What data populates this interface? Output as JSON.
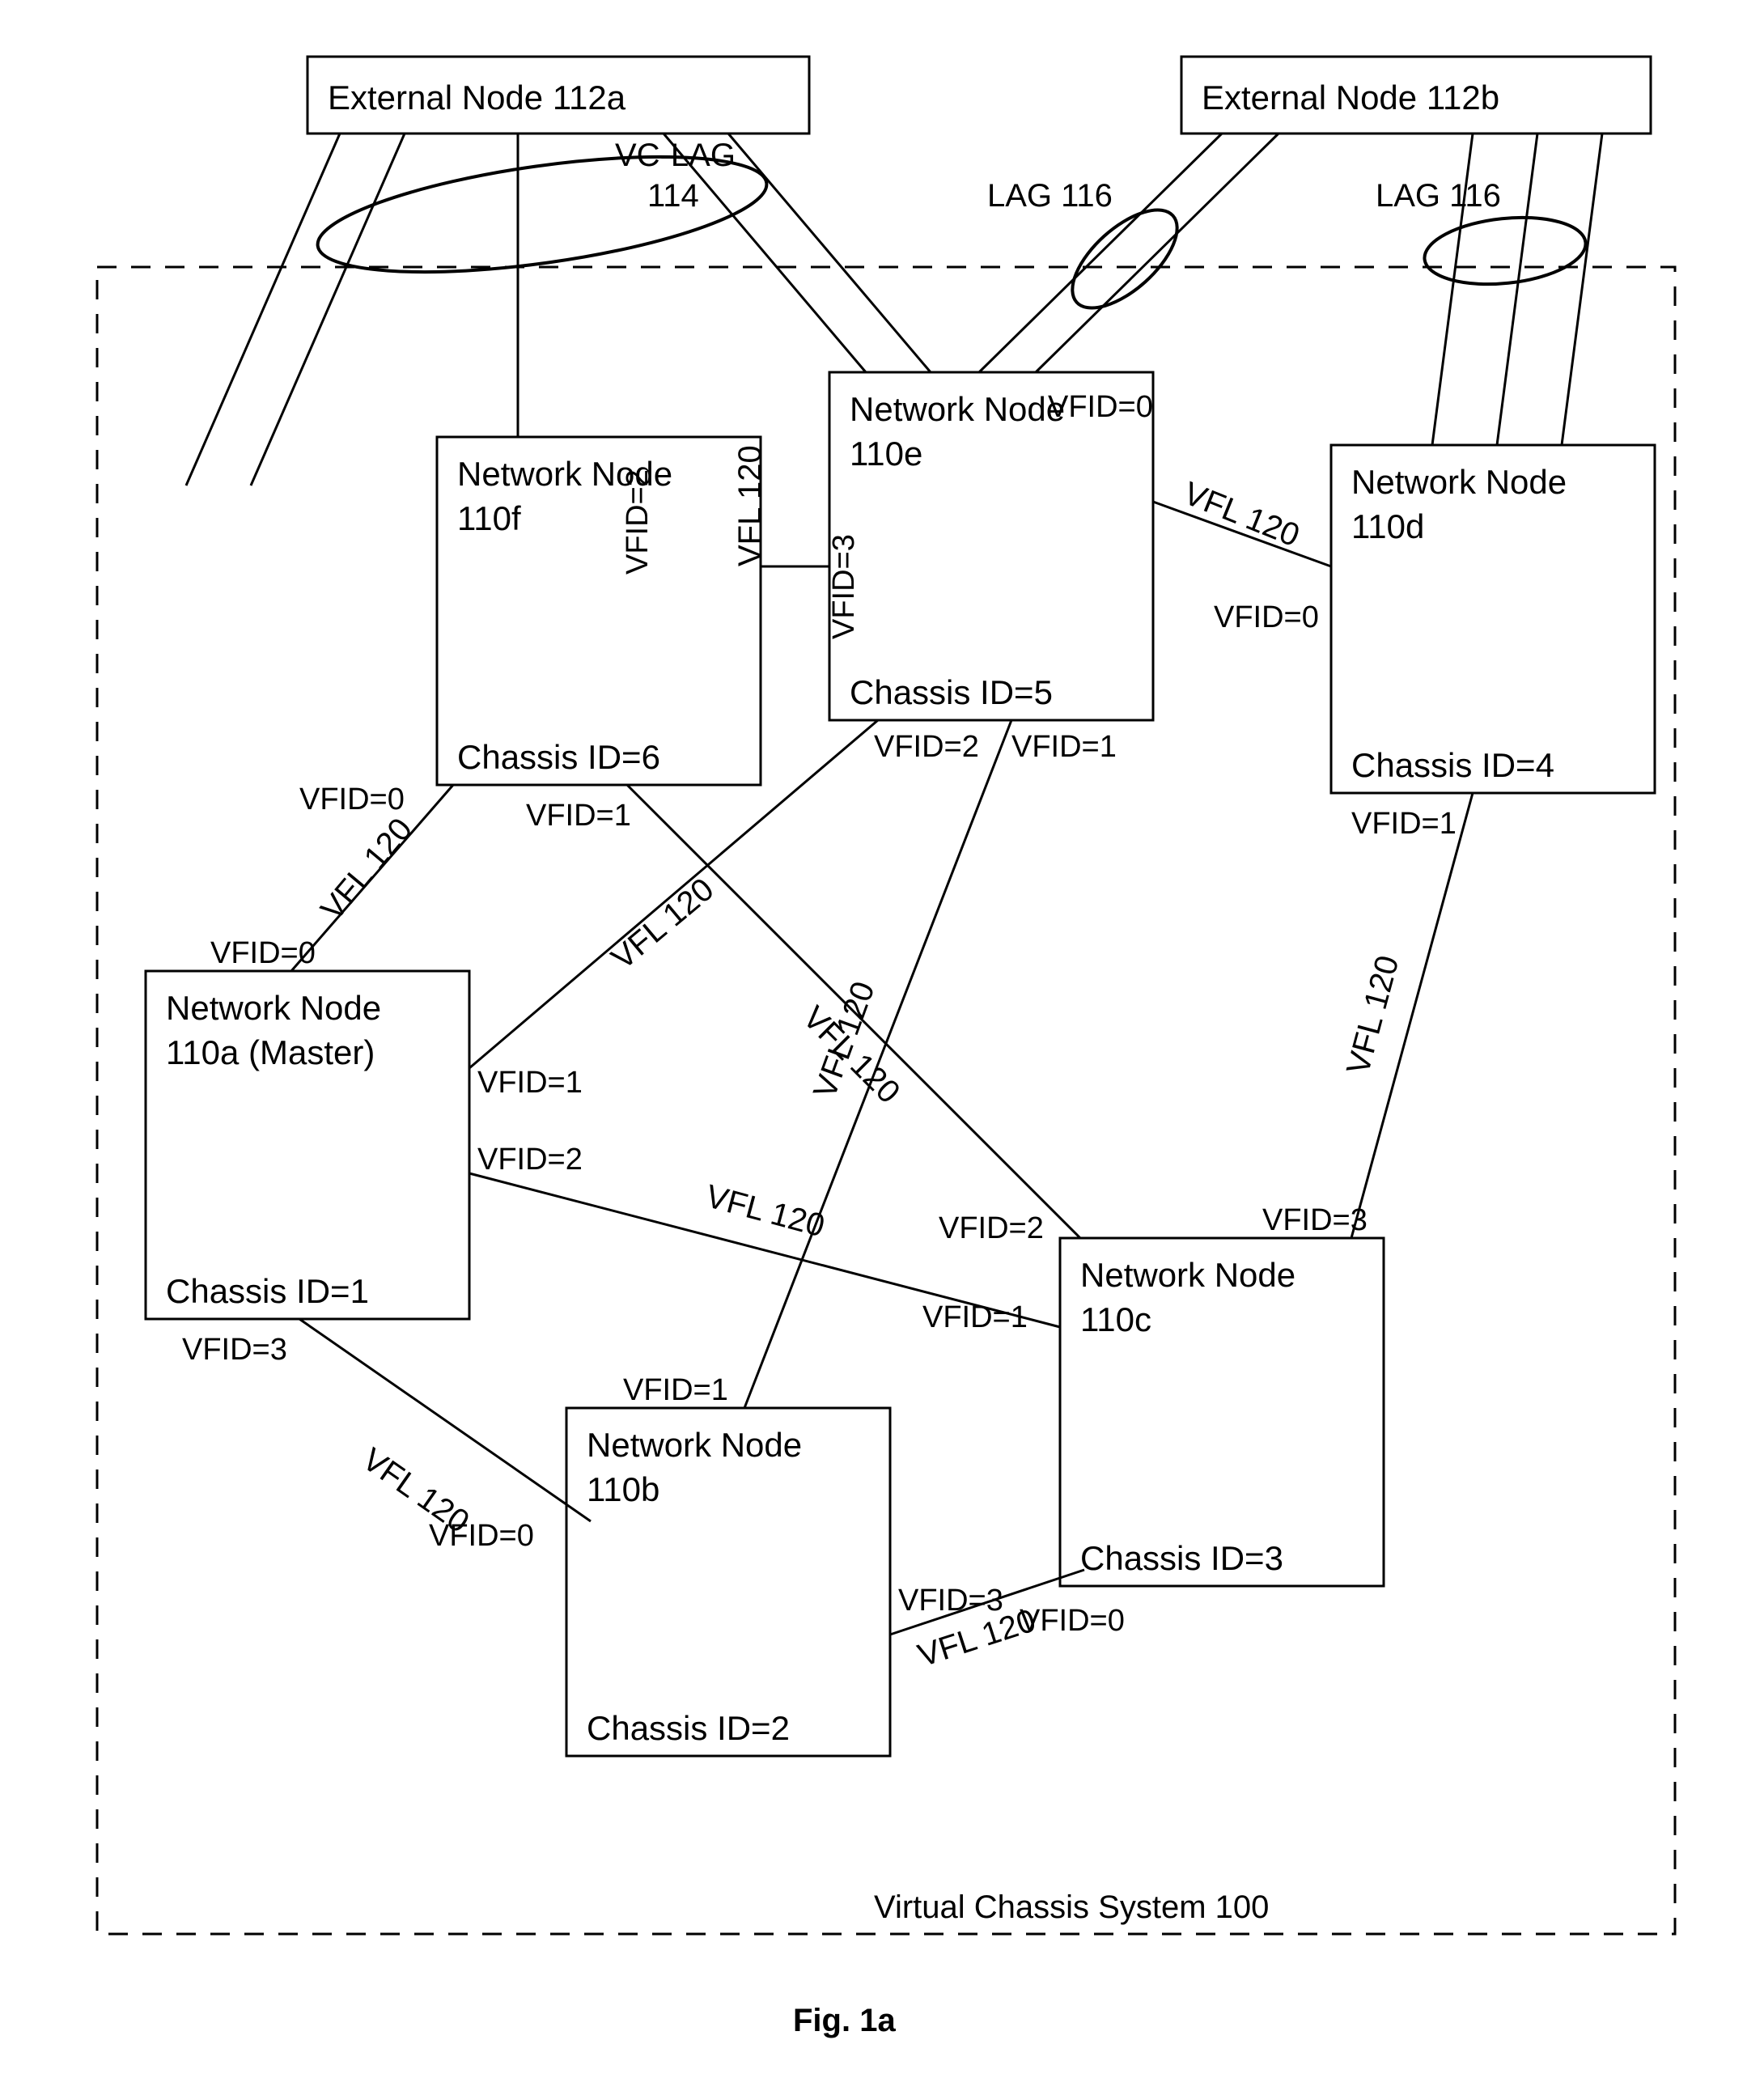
{
  "figure_label": "Fig. 1a",
  "system_label": "Virtual Chassis System 100",
  "external_nodes": {
    "a": {
      "label": "External Node 112a"
    },
    "b": {
      "label": "External Node 112b"
    }
  },
  "lag": {
    "vc_lag": {
      "name": "VC-LAG",
      "num": "114"
    },
    "lag1": {
      "label": "LAG 116"
    },
    "lag2": {
      "label": "LAG 116"
    }
  },
  "nodes": {
    "a": {
      "title": "Network Node",
      "sub": "110a (Master)",
      "chassis": "Chassis ID=1"
    },
    "b": {
      "title": "Network Node",
      "sub": "110b",
      "chassis": "Chassis ID=2"
    },
    "c": {
      "title": "Network Node",
      "sub": "110c",
      "chassis": "Chassis ID=3"
    },
    "d": {
      "title": "Network Node",
      "sub": "110d",
      "chassis": "Chassis ID=4"
    },
    "e": {
      "title": "Network Node",
      "sub": "110e",
      "chassis": "Chassis ID=5"
    },
    "f": {
      "title": "Network Node",
      "sub": "110f",
      "chassis": "Chassis ID=6"
    }
  },
  "vfl_label": "VFL 120",
  "ports": {
    "a_top": "VFID=0",
    "a_r1": "VFID=1",
    "a_r2": "VFID=2",
    "a_bot": "VFID=3",
    "b_tl": "VFID=0",
    "b_tr": "VFID=1",
    "b_r": "VFID=3",
    "c_l1": "VFID=1",
    "c_l2": "VFID=2",
    "c_t": "VFID=3",
    "c_b": "VFID=0",
    "d_tl": "VFID=0",
    "d_bl": "VFID=1",
    "e_tr": "VFID=0",
    "e_r": "VFID=1",
    "e_b": "VFID=2",
    "e_l": "VFID=3",
    "f_l": "VFID=0",
    "f_b": "VFID=1",
    "f_r": "VFID=2"
  }
}
